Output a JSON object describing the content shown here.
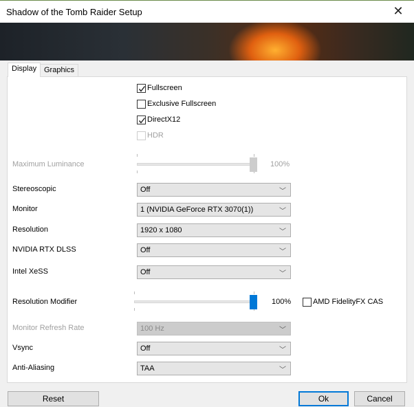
{
  "window": {
    "title": "Shadow of the Tomb Raider Setup",
    "close_icon": "close-icon"
  },
  "tabs": [
    {
      "label": "Display",
      "active": true
    },
    {
      "label": "Graphics",
      "active": false
    }
  ],
  "checkboxes": [
    {
      "label": "Fullscreen",
      "checked": true,
      "enabled": true
    },
    {
      "label": "Exclusive Fullscreen",
      "checked": false,
      "enabled": true
    },
    {
      "label": "DirectX12",
      "checked": true,
      "enabled": true
    },
    {
      "label": "HDR",
      "checked": false,
      "enabled": false
    }
  ],
  "max_luminance": {
    "label": "Maximum Luminance",
    "value_text": "100%",
    "value": 100,
    "enabled": false
  },
  "settings": [
    {
      "label": "Stereoscopic",
      "value": "Off",
      "enabled": true
    },
    {
      "label": "Monitor",
      "value": "1 (NVIDIA GeForce RTX 3070(1))",
      "enabled": true
    },
    {
      "label": "Resolution",
      "value": "1920 x 1080",
      "enabled": true
    },
    {
      "label": "NVIDIA RTX DLSS",
      "value": "Off",
      "enabled": true
    },
    {
      "label": "Intel XeSS",
      "value": "Off",
      "enabled": true
    }
  ],
  "resolution_modifier": {
    "label": "Resolution Modifier",
    "value_text": "100%",
    "value": 100,
    "cas_label": "AMD FidelityFX CAS",
    "cas_checked": false
  },
  "settings2": [
    {
      "label": "Monitor Refresh Rate",
      "value": "100 Hz",
      "enabled": false
    },
    {
      "label": "Vsync",
      "value": "Off",
      "enabled": true
    },
    {
      "label": "Anti-Aliasing",
      "value": "TAA",
      "enabled": true
    }
  ],
  "buttons": {
    "reset": "Reset",
    "ok": "Ok",
    "cancel": "Cancel"
  },
  "colors": {
    "accent": "#0078d7"
  }
}
